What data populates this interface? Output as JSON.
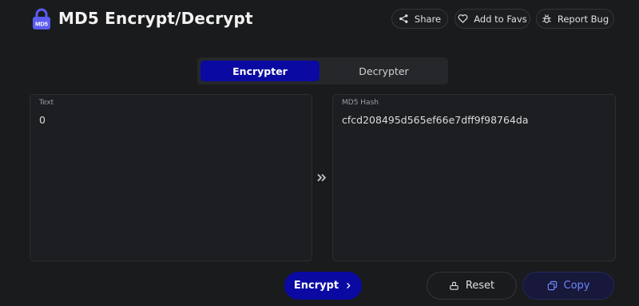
{
  "header": {
    "title": "MD5 Encrypt/Decrypt",
    "logo_text": "MD5",
    "share_label": "Share",
    "favs_label": "Add to Favs",
    "bug_label": "Report Bug"
  },
  "tabs": [
    {
      "label": "Encrypter",
      "active": true
    },
    {
      "label": "Decrypter",
      "active": false
    }
  ],
  "input_panel": {
    "label": "Text",
    "value": "0"
  },
  "output_panel": {
    "label": "MD5 Hash",
    "value": "cfcd208495d565ef66e7dff9f98764da"
  },
  "actions": {
    "encrypt_label": "Encrypt",
    "reset_label": "Reset",
    "copy_label": "Copy"
  },
  "colors": {
    "accent": "#0a0aa3",
    "logo": "#5b5cf0",
    "background": "#1a1b1d",
    "copy_text": "#6e86ff"
  },
  "icons": [
    "lock-icon",
    "share-icon",
    "heart-icon",
    "bug-icon",
    "double-chevron-right-icon",
    "chevron-right-icon",
    "reset-icon",
    "copy-icon"
  ]
}
